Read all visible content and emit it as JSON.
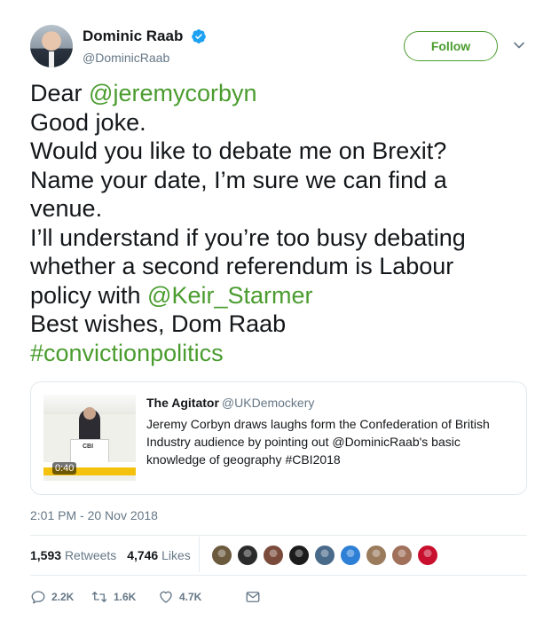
{
  "author": {
    "display_name": "Dominic Raab",
    "handle": "@DominicRaab",
    "verified_icon": "verified-badge-icon"
  },
  "follow_label": "Follow",
  "tweet": {
    "lines": [
      {
        "text": "Dear ",
        "mention": "@jeremycorbyn"
      },
      {
        "text": "Good joke."
      },
      {
        "text": "Would you like to debate me on Brexit?"
      },
      {
        "text": "Name your date, I’m sure we can find a"
      },
      {
        "text": "venue."
      },
      {
        "text": "I’ll understand if you’re too busy debating"
      },
      {
        "text": "whether a second referendum is Labour"
      },
      {
        "text": "policy with ",
        "mention": "@Keir_Starmer"
      },
      {
        "text": "Best wishes, Dom Raab"
      },
      {
        "hashtag": "#convictionpolitics"
      }
    ]
  },
  "quote": {
    "name": "The Agitator",
    "handle": "@UKDemockery",
    "text": "Jeremy Corbyn draws laughs form the Confederation of British Industry audience by pointing out @DominicRaab's basic knowledge of geography #CBI2018",
    "video_duration": "0:40",
    "thumb_label": "CBI"
  },
  "timestamp": "2:01 PM - 20 Nov 2018",
  "stats": {
    "retweets_count": "1,593",
    "retweets_label": "Retweets",
    "likes_count": "4,746",
    "likes_label": "Likes"
  },
  "likers": [
    {
      "color": "#6b5a3e"
    },
    {
      "color": "#2b2b2b"
    },
    {
      "color": "#7a4a3a"
    },
    {
      "color": "#1c1c1c"
    },
    {
      "color": "#4a6a8a"
    },
    {
      "color": "#2e7fd6"
    },
    {
      "color": "#9a7b5c"
    },
    {
      "color": "#a0705a"
    },
    {
      "color": "#c8102e"
    }
  ],
  "actions": {
    "reply_count": "2.2K",
    "retweet_count": "1.6K",
    "like_count": "4.7K"
  },
  "colors": {
    "link": "#4a9c2f",
    "verified": "#1da1f2",
    "muted": "#657786"
  }
}
